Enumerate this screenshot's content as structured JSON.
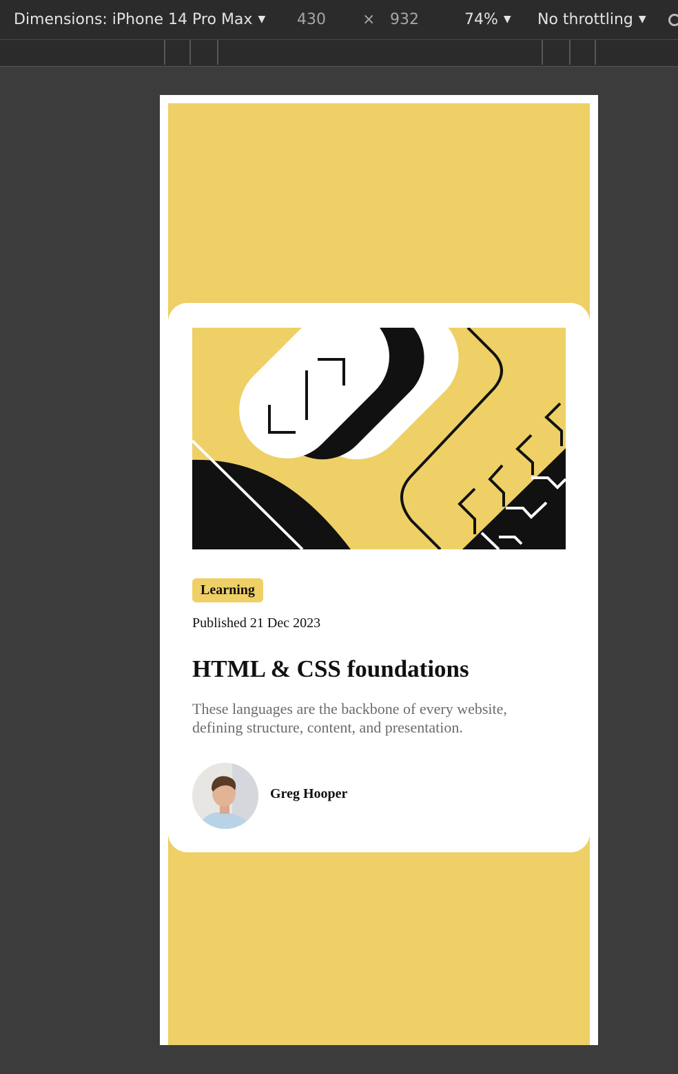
{
  "devtools": {
    "dimensions_label": "Dimensions: iPhone 14 Pro Max",
    "width_value": "430",
    "times": "×",
    "height_value": "932",
    "zoom": "74%",
    "throttling": "No throttling",
    "caret_icon": "caret-down-icon",
    "rotate_icon": "rotate-icon"
  },
  "colors": {
    "page_background": "#eed066",
    "card": "#ffffff",
    "accent_yellow": "#eed066",
    "text_dark": "#111111",
    "text_muted": "#6b6b6b"
  },
  "card": {
    "image_icon": "abstract-illustration",
    "tag": "Learning",
    "published": "Published 21 Dec 2023",
    "title": "HTML & CSS foundations",
    "description": "These languages are the backbone of every website, defining structure, content, and presentation.",
    "author": {
      "name": "Greg Hooper",
      "avatar_icon": "avatar-photo"
    }
  }
}
